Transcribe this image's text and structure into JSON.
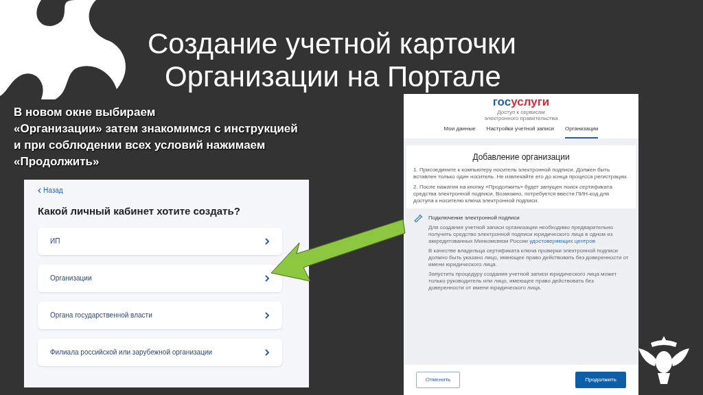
{
  "slide": {
    "title_lines": [
      "Создание учетной карточки",
      "Организации на Портале"
    ],
    "instruction_lines": [
      "В новом окне выбираем",
      "«Организации» затем знакомимся с инструкцией",
      "и при соблюдении всех условий нажимаем",
      "«Продолжить»"
    ]
  },
  "left_screen": {
    "back_link": "Назад",
    "heading": "Какой личный кабинет хотите создать?",
    "options": [
      {
        "label": "ИП"
      },
      {
        "label": "Организации"
      },
      {
        "label": "Органа государственной власти"
      },
      {
        "label": "Филиала российской или зарубежной организации"
      }
    ]
  },
  "right_screen": {
    "logo_part_1": "гос",
    "logo_part_2": "услуги",
    "logo_subtitle_lines": [
      "Доступ к сервисам",
      "электронного правительства"
    ],
    "tabs": [
      {
        "label": "Мои данные",
        "selected": false
      },
      {
        "label": "Настройки учетной записи",
        "selected": false
      },
      {
        "label": "Организации",
        "selected": true
      }
    ],
    "card_title": "Добавление организации",
    "steps": [
      "1. Присоедините к компьютеру носитель электронной подписи. Должен быть вставлен только один носитель. Не извлекайте его до конца процесса регистрации.",
      "2. После нажатия на кнопку «Продолжить» будет запущен поиск сертификата средства электронной подписи. Возможно, потребуется ввести ПИН-код для доступа к носителю ключа электронной подписи."
    ],
    "info_title": "Подключение электронной подписи",
    "info_paragraph_1": "Для создания учетной записи организации необходимо предварительно получить средство электронной подписи юридического лица в одном из аккредитованных Минкомсвязи России",
    "info_link": "удостоверяющих центров",
    "info_paragraphs": [
      "В качестве владельца сертификата ключа проверки электронной подписи должно быть указано лицо, имеющее право действовать без доверенности от имени юридического лица.",
      "Запустить процедуру создания учетной записи юридического лица может только руководитель или лицо, имеющее право действовать без доверенности от имени юридического лица."
    ],
    "cancel_button": "Отменить",
    "continue_button": "Продолжить"
  }
}
